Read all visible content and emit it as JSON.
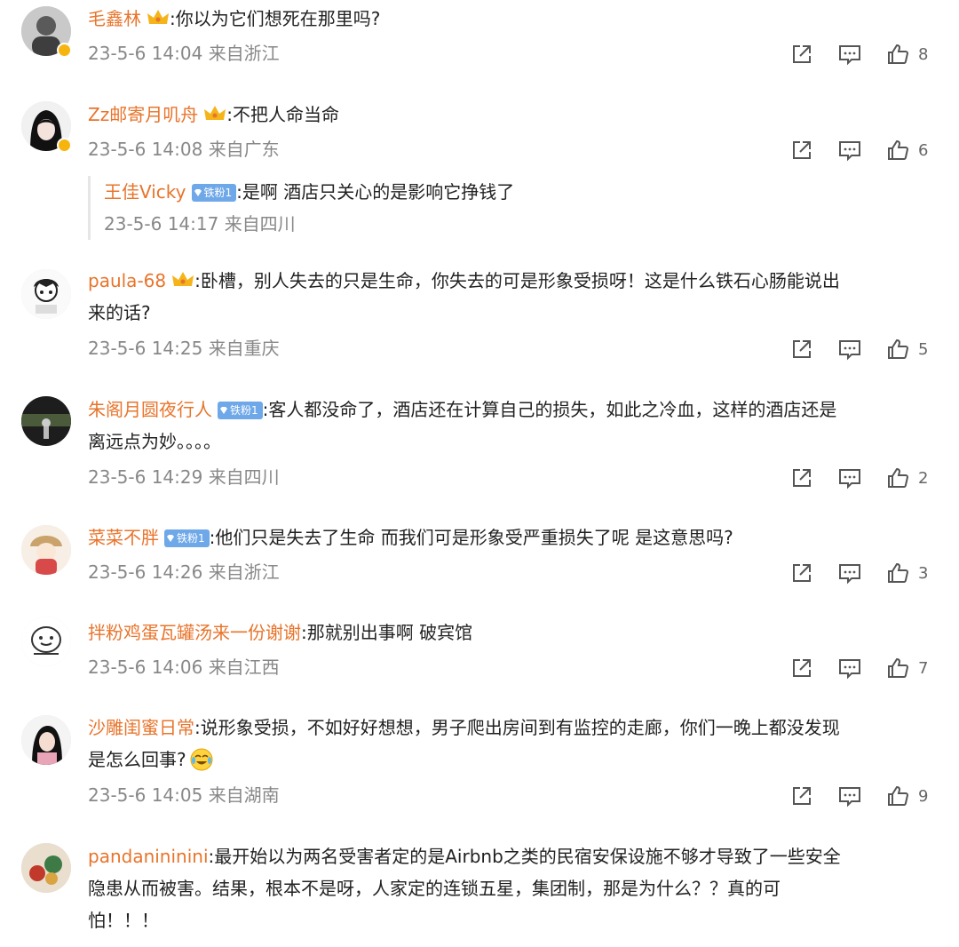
{
  "colors": {
    "name": "#e8742b",
    "meta": "#888888",
    "fan_badge": "#6fa8e8"
  },
  "comments": [
    {
      "name": "毛鑫林",
      "text": ":你以为它们想死在那里吗?",
      "time": "23-5-6 14:04",
      "location": "来自浙江",
      "likes": "8"
    },
    {
      "name": "Zz邮寄月叽舟",
      "text": ":不把人命当命",
      "time": "23-5-6 14:08",
      "location": "来自广东",
      "likes": "6",
      "reply": {
        "name": "王佳Vicky",
        "badge": "铁粉1",
        "text": ":是啊 酒店只关心的是影响它挣钱了",
        "time": "23-5-6 14:17",
        "location": "来自四川"
      }
    },
    {
      "name": "paula-68",
      "text": ":卧槽，别人失去的只是生命，你失去的可是形象受损呀！这是什么铁石心肠能说出",
      "text2": "来的话?",
      "time": "23-5-6 14:25",
      "location": "来自重庆",
      "likes": "5"
    },
    {
      "name": "朱阁月圆夜行人",
      "badge": "铁粉1",
      "text": ":客人都没命了，酒店还在计算自己的损失，如此之冷血，这样的酒店还是",
      "text2": "离远点为妙。。。。",
      "time": "23-5-6 14:29",
      "location": "来自四川",
      "likes": "2"
    },
    {
      "name": "菜菜不胖",
      "badge": "铁粉1",
      "text": ":他们只是失去了生命  而我们可是形象受严重损失了呢  是这意思吗?",
      "time": "23-5-6 14:26",
      "location": "来自浙江",
      "likes": "3"
    },
    {
      "name": "拌粉鸡蛋瓦罐汤来一份谢谢",
      "text": ":那就别出事啊 破宾馆",
      "time": "23-5-6 14:06",
      "location": "来自江西",
      "likes": "7"
    },
    {
      "name": "沙雕闺蜜日常",
      "text": ":说形象受损，不如好好想想，男子爬出房间到有监控的走廊，你们一晚上都没发现",
      "text2": "是怎么回事?",
      "time": "23-5-6 14:05",
      "location": "来自湖南",
      "likes": "9"
    },
    {
      "name": "pandanininini",
      "text": ":最开始以为两名受害者定的是Airbnb之类的民宿安保设施不够才导致了一些安全",
      "text2": "隐患从而被害。结果，根本不是呀，人家定的连锁五星，集团制，那是为什么？？真的可",
      "text3": "怕！！！"
    }
  ]
}
